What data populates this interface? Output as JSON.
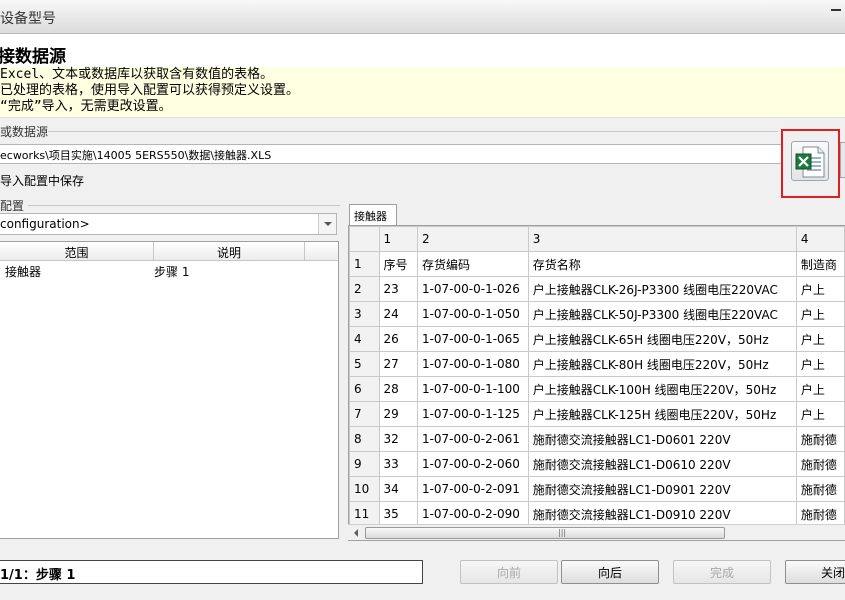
{
  "window": {
    "title": "设备型号"
  },
  "header": {
    "heading": "接数据源",
    "instructions": [
      "Excel、文本或数据库以获取含有数值的表格。",
      "已处理的表格，使用导入配置可以获得预定义设置。",
      "“完成”导入，无需更改设置。"
    ]
  },
  "source": {
    "section_label": "或数据源",
    "path": "ecworks\\项目实施\\14005 5ERS550\\数据\\接触器.XLS",
    "save_label": "导入配置中保存",
    "excel_icon": "excel-file-icon"
  },
  "config": {
    "section_label": "配置",
    "selected": "configuration>",
    "columns": [
      "范围",
      "说明"
    ],
    "rows": [
      {
        "range": "接触器",
        "desc": "步骤 1"
      }
    ]
  },
  "sheet": {
    "tab_label": "接触器",
    "col_numbers": [
      "1",
      "2",
      "3",
      "4"
    ],
    "rows": [
      {
        "num": "1",
        "cells": [
          "序号",
          "存货编码",
          "存货名称",
          "制造商"
        ]
      },
      {
        "num": "2",
        "cells": [
          "23",
          "1-07-00-0-1-026",
          "户上接触器CLK-26J-P3300  线圈电压220VAC",
          "户上"
        ]
      },
      {
        "num": "3",
        "cells": [
          "24",
          "1-07-00-0-1-050",
          "户上接触器CLK-50J-P3300  线圈电压220VAC",
          "户上"
        ]
      },
      {
        "num": "4",
        "cells": [
          "26",
          "1-07-00-0-1-065",
          "户上接触器CLK-65H     线圈电压220V，50Hz",
          "户上"
        ]
      },
      {
        "num": "5",
        "cells": [
          "27",
          "1-07-00-0-1-080",
          "户上接触器CLK-80H     线圈电压220V，50Hz",
          "户上"
        ]
      },
      {
        "num": "6",
        "cells": [
          "28",
          "1-07-00-0-1-100",
          "户上接触器CLK-100H    线圈电压220V，50Hz",
          "户上"
        ]
      },
      {
        "num": "7",
        "cells": [
          "29",
          "1-07-00-0-1-125",
          "户上接触器CLK-125H    线圈电压220V，50Hz",
          "户上"
        ]
      },
      {
        "num": "8",
        "cells": [
          "32",
          "1-07-00-0-2-061",
          "施耐德交流接触器LC1-D0601 220V",
          "施耐德"
        ]
      },
      {
        "num": "9",
        "cells": [
          "33",
          "1-07-00-0-2-060",
          "施耐德交流接触器LC1-D0610 220V",
          "施耐德"
        ]
      },
      {
        "num": "10",
        "cells": [
          "34",
          "1-07-00-0-2-091",
          "施耐德交流接触器LC1-D0901 220V",
          "施耐德"
        ]
      },
      {
        "num": "11",
        "cells": [
          "35",
          "1-07-00-0-2-090",
          "施耐德交流接触器LC1-D0910 220V",
          "施耐德"
        ]
      }
    ]
  },
  "footer": {
    "status": "1/1：步骤 1",
    "buttons": {
      "prev": "向前",
      "next": "向后",
      "finish": "完成",
      "close": "关闭"
    }
  }
}
